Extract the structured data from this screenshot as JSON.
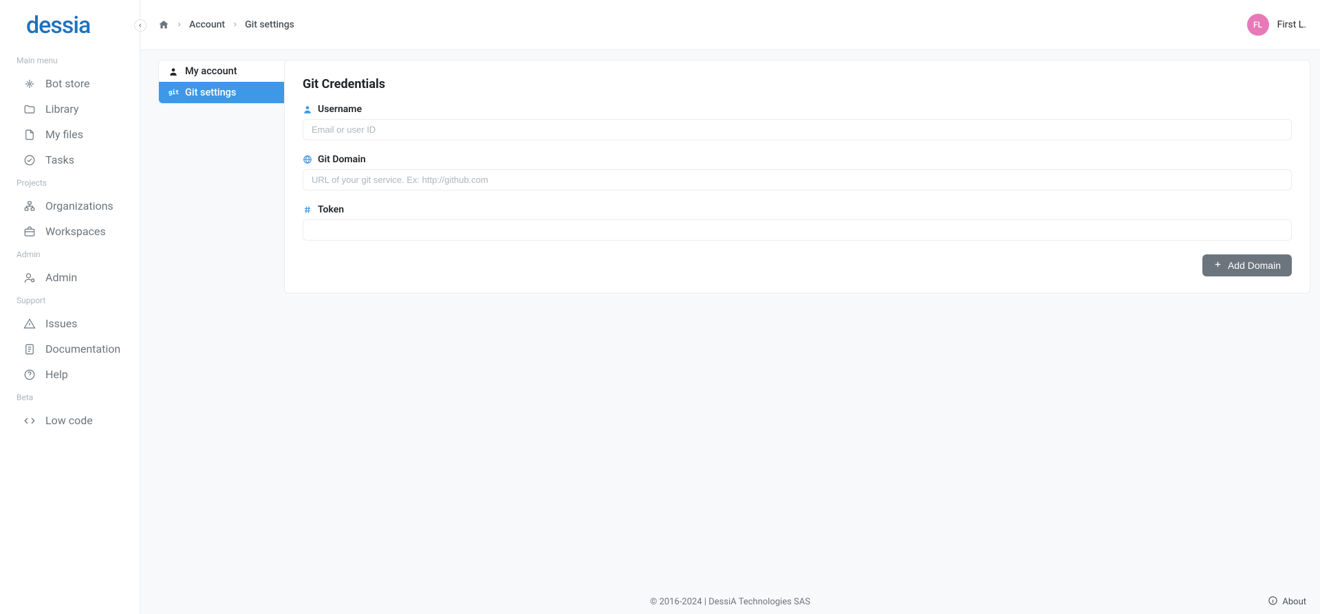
{
  "brand": "dessia",
  "breadcrumb": {
    "home_aria": "Home",
    "items": [
      "Account",
      "Git settings"
    ]
  },
  "user": {
    "initials": "FL",
    "display_name": "First L."
  },
  "sidebar": {
    "sections": [
      {
        "title": "Main menu",
        "items": [
          {
            "icon": "bot-store-icon",
            "label": "Bot store"
          },
          {
            "icon": "folder-icon",
            "label": "Library"
          },
          {
            "icon": "file-icon",
            "label": "My files"
          },
          {
            "icon": "check-circle-icon",
            "label": "Tasks"
          }
        ]
      },
      {
        "title": "Projects",
        "items": [
          {
            "icon": "org-icon",
            "label": "Organizations"
          },
          {
            "icon": "briefcase-icon",
            "label": "Workspaces"
          }
        ]
      },
      {
        "title": "Admin",
        "items": [
          {
            "icon": "admin-icon",
            "label": "Admin"
          }
        ]
      },
      {
        "title": "Support",
        "items": [
          {
            "icon": "warning-icon",
            "label": "Issues"
          },
          {
            "icon": "doc-icon",
            "label": "Documentation"
          },
          {
            "icon": "help-icon",
            "label": "Help"
          }
        ]
      },
      {
        "title": "Beta",
        "items": [
          {
            "icon": "code-icon",
            "label": "Low code"
          }
        ]
      }
    ]
  },
  "subnav": {
    "items": [
      {
        "icon": "person-icon",
        "label": "My account",
        "active": false,
        "git": false
      },
      {
        "icon": "git-icon",
        "label": "Git settings",
        "active": true,
        "git": true
      }
    ]
  },
  "panel": {
    "title": "Git Credentials",
    "fields": {
      "username": {
        "label": "Username",
        "placeholder": "Email or user ID",
        "value": ""
      },
      "domain": {
        "label": "Git Domain",
        "placeholder": "URL of your git service. Ex: http://github.com",
        "value": ""
      },
      "token": {
        "label": "Token",
        "placeholder": "",
        "value": ""
      }
    },
    "add_button": "Add Domain"
  },
  "footer": {
    "copyright": "© 2016-2024 | DessiA Technologies SAS",
    "about": "About"
  }
}
